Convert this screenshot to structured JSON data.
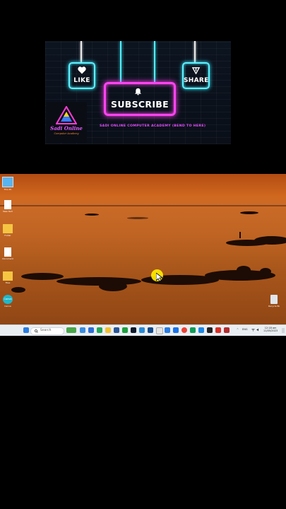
{
  "banner": {
    "like_label": "LIKE",
    "share_label": "SHARE",
    "subscribe_label": "SUBSCRIBE",
    "logo_title": "Sadi Online",
    "logo_subtitle": "Computer Academy",
    "academy_caption": "SADI ONLINE COMPUTER ACADEMY (BEND TO HERE)",
    "colors": {
      "cyan_neon": "#4ff0ff",
      "pink_neon": "#ff44f0",
      "caption": "#e24bff"
    }
  },
  "desktop": {
    "icons": [
      {
        "name": "monitor-icon",
        "caption": "This PC"
      },
      {
        "name": "document-icon",
        "caption": "New Text"
      },
      {
        "name": "folder-icon",
        "caption": "Folder"
      },
      {
        "name": "document-icon",
        "caption": "Document"
      },
      {
        "name": "folder-icon",
        "caption": "Files"
      },
      {
        "name": "canva-icon",
        "caption": "Canva"
      }
    ],
    "recycle_bin_caption": "Recycle Bin",
    "canva_label": "Canva"
  },
  "taskbar": {
    "search_placeholder": "Search",
    "tray_lang": "ENG",
    "clock_time": "12:18 am",
    "clock_date": "11/05/2023"
  }
}
